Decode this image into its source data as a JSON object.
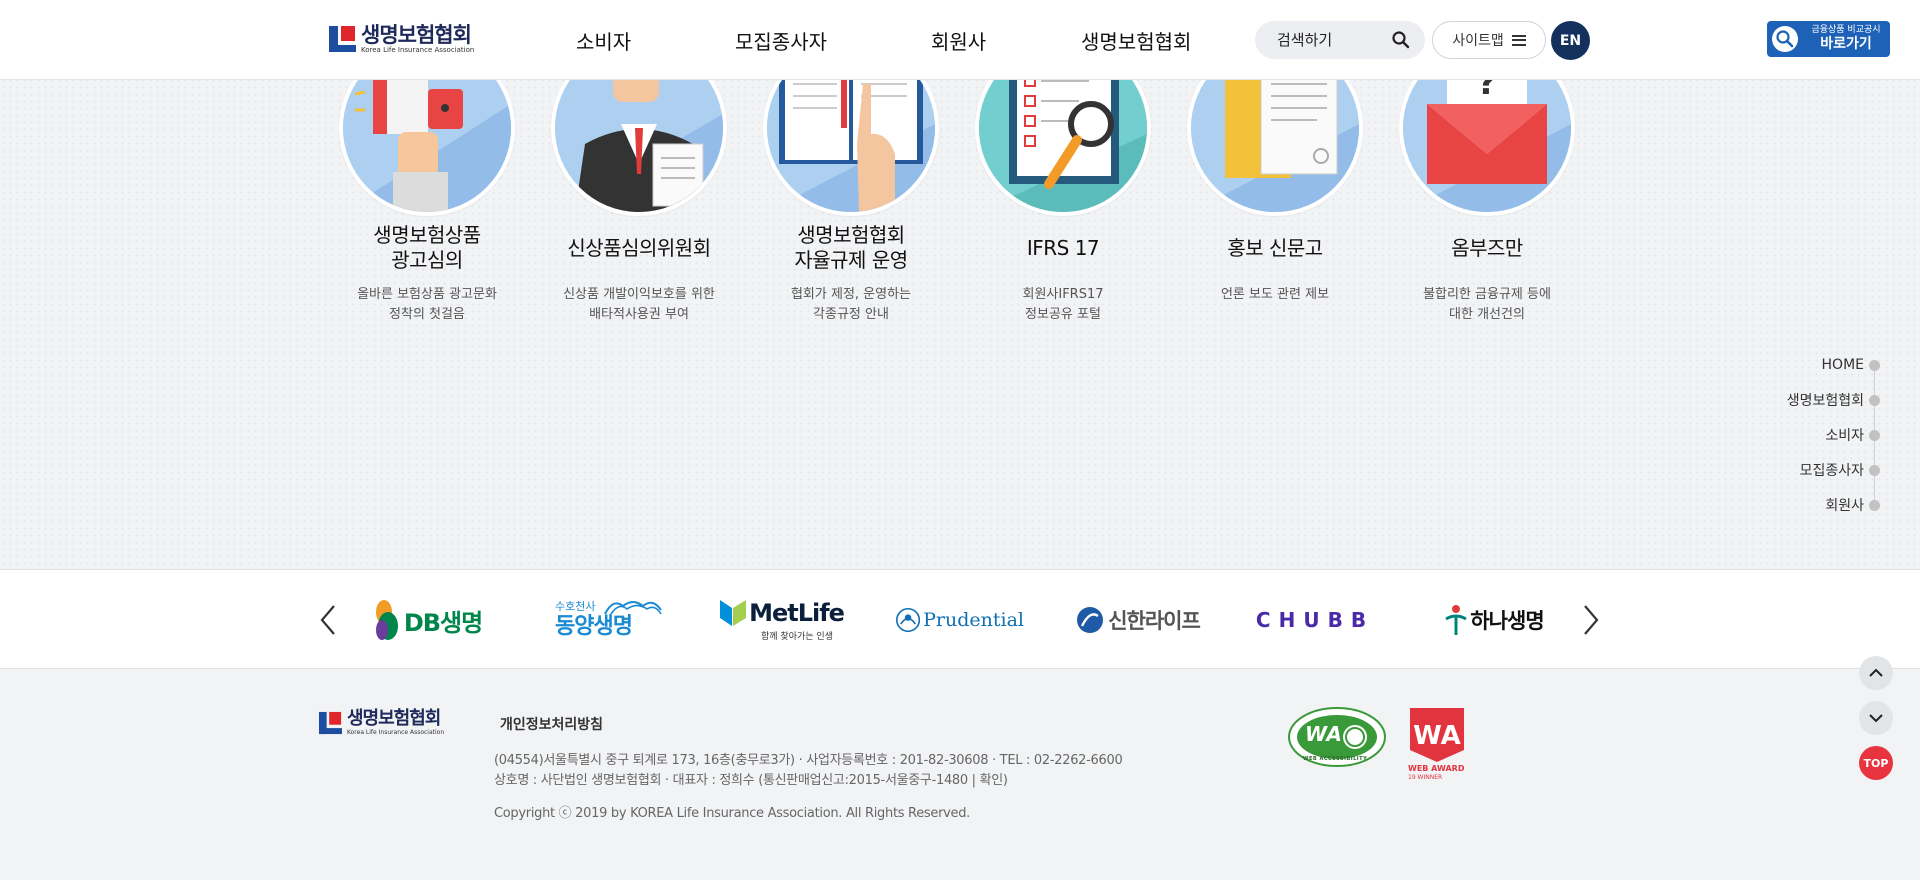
{
  "header": {
    "logo_ko": "생명보험협회",
    "logo_en": "Korea Life Insurance Association",
    "nav": [
      "소비자",
      "모집종사자",
      "회원사",
      "생명보험협회"
    ],
    "search_placeholder": "검색하기",
    "sitemap_label": "사이트맵",
    "lang_label": "EN",
    "compare_banner_line1": "금융상품 비교공시",
    "compare_banner_line2": "바로가기"
  },
  "services": [
    {
      "title": "생명보험상품\n광고심의",
      "desc": "올바른 보험상품 광고문화\n정착의 첫걸음",
      "icon": "megaphone-icon"
    },
    {
      "title": "신상품심의위원회",
      "desc": "신상품 개발이익보호를 위한\n배타적사용권 부여",
      "icon": "businessman-icon"
    },
    {
      "title": "생명보험협회\n자율규제 운영",
      "desc": "협회가 제정, 운영하는\n각종규정 안내",
      "icon": "book-icon"
    },
    {
      "title": "IFRS 17",
      "desc": "회원사IFRS17\n정보공유 포털",
      "icon": "checklist-magnifier-icon"
    },
    {
      "title": "홍보 신문고",
      "desc": "언론 보도 관련 제보",
      "icon": "folder-document-icon"
    },
    {
      "title": "옴부즈만",
      "desc": "불합리한 금융규제 등에\n대한 개선건의",
      "icon": "envelope-question-icon"
    }
  ],
  "quick_nav": [
    "HOME",
    "생명보험협회",
    "소비자",
    "모집종사자",
    "회원사"
  ],
  "partners": [
    {
      "name": "DB생명",
      "color": "#00854a"
    },
    {
      "name": "동양생명",
      "sub": "수호천사",
      "color": "#1a8ad4"
    },
    {
      "name": "MetLife",
      "sub": "함께 찾아가는 인생",
      "color": "#0a1f3c"
    },
    {
      "name": "Prudential",
      "color": "#0f6fb3"
    },
    {
      "name": "신한라이프",
      "color": "#555555"
    },
    {
      "name": "CHUBB",
      "color": "#4a2aa8"
    },
    {
      "name": "하나생명",
      "color": "#111111"
    }
  ],
  "footer": {
    "logo_ko": "생명보험협회",
    "logo_en": "Korea Life Insurance Association",
    "privacy_link": "개인정보처리방침",
    "address_line1": "(04554)서울특별시 중구 퇴계로 173, 16층(충무로3가) ·  사업자등록번호 : 201-82-30608 ·  TEL : 02-2262-6600",
    "address_line2": "상호명 : 사단법인 생명보험협회 ·  대표자 : 정희수 (통신판매업신고:2015-서울중구-1480 | 확인)",
    "copyright": "Copyright ⓒ 2019 by KOREA Life Insurance Association. All Rights Reserved.",
    "wa_text": "WA",
    "wa_sub": "WEB ACCESSIBILITY",
    "webaward_line1": "WEB AWARD",
    "webaward_line2": "19 WINNER"
  },
  "scroll": {
    "top_label": "TOP"
  },
  "colors": {
    "brand_navy": "#13315c",
    "brand_red": "#e1262b",
    "top_btn": "#e8343f"
  }
}
